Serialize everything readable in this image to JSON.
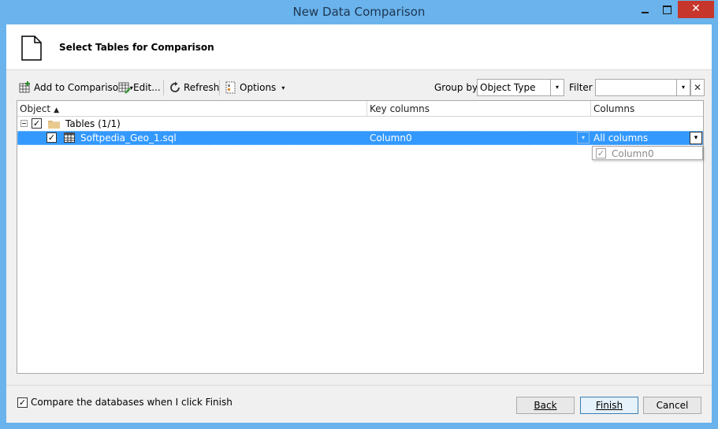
{
  "window": {
    "title": "New Data Comparison",
    "close_glyph": "✕"
  },
  "header": {
    "title": "Select Tables for Comparison",
    "icon": "document-icon"
  },
  "toolbar": {
    "add_label": "Add to Comparison",
    "edit_label": "Edit...",
    "refresh_label": "Refresh",
    "options_label": "Options",
    "group_by_label": "Group by",
    "group_by_value": "Object Type",
    "filter_label": "Filter",
    "filter_value": "",
    "caret": "▾",
    "clear_glyph": "✕"
  },
  "grid": {
    "columns": [
      "Object",
      "Key columns",
      "Columns"
    ],
    "sort_glyph": "▲",
    "group_row": {
      "label": "Tables (1/1)",
      "checked": true
    },
    "rows": [
      {
        "object": "Softpedia_Geo_1.sql",
        "key_columns": "Column0",
        "columns": "All columns",
        "checked": true
      }
    ],
    "columns_dropdown": {
      "items": [
        "Column0"
      ]
    }
  },
  "footer": {
    "option_label": "Compare the databases when I click Finish",
    "option_checked": true,
    "back_label": "Back",
    "finish_label": "Finish",
    "cancel_label": "Cancel"
  },
  "colors": {
    "titlebar": "#6ab3ec",
    "selection": "#3399ff",
    "close_button": "#c7362b"
  }
}
